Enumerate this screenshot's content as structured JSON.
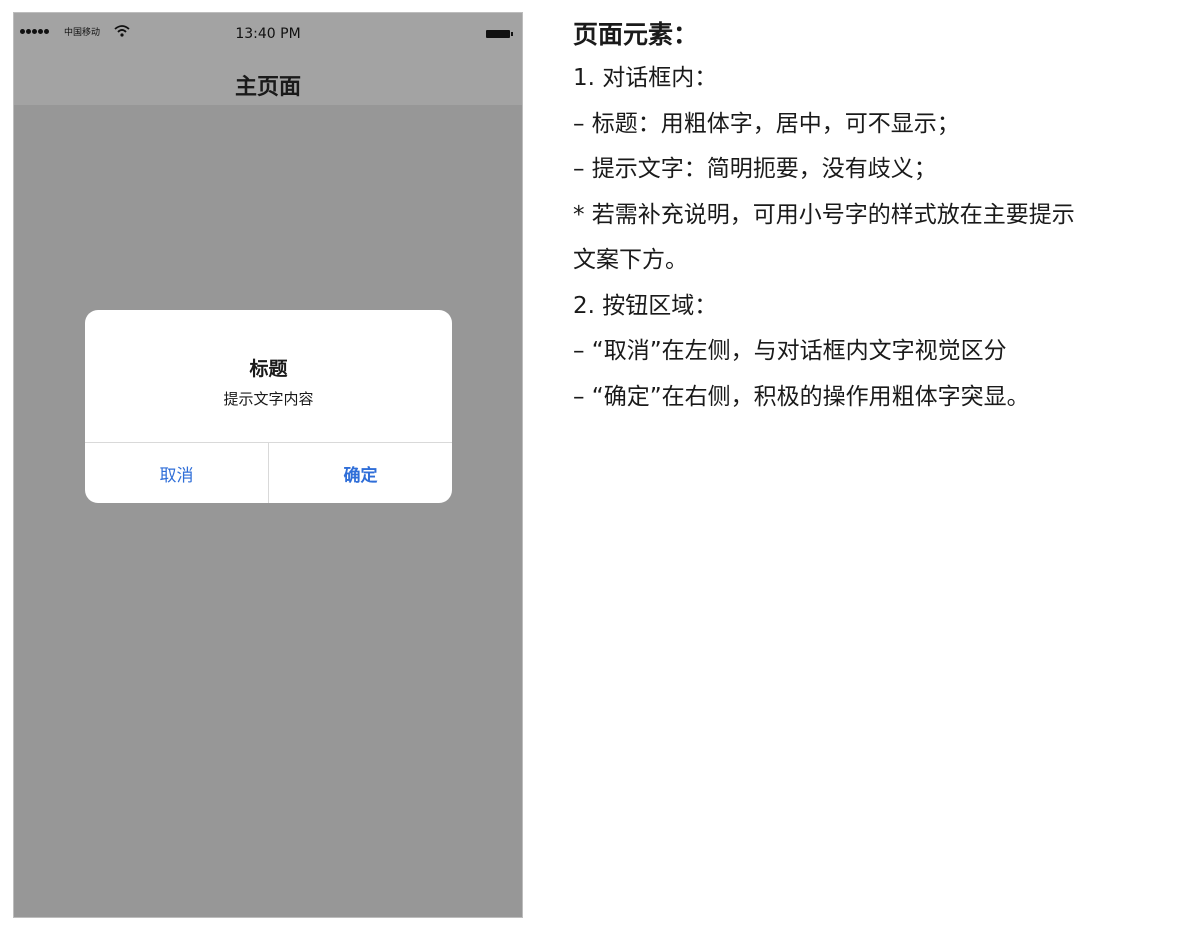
{
  "status_bar": {
    "carrier": "中国移动",
    "time": "13:40 PM"
  },
  "nav": {
    "title": "主页面"
  },
  "dialog": {
    "title": "标题",
    "message": "提示文字内容",
    "cancel_label": "取消",
    "confirm_label": "确定"
  },
  "description": {
    "heading": "页面元素：",
    "lines": [
      "1. 对话框内：",
      "– 标题：用粗体字，居中，可不显示；",
      "– 提示文字：简明扼要，没有歧义；",
      "* 若需补充说明，可用小号字的样式放在主要提示",
      "文案下方。",
      "2. 按钮区域：",
      "– “取消”在左侧，与对话框内文字视觉区分",
      "– “确定”在右侧，积极的操作用粗体字突显。"
    ]
  },
  "colors": {
    "overlay": "#979797",
    "button_text": "#2f6ed8",
    "dialog_bg": "#ffffff"
  }
}
